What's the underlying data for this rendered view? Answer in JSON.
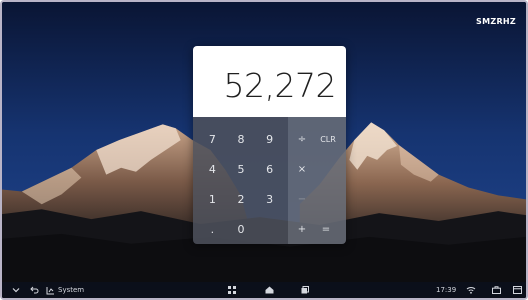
{
  "overlay": {
    "badge": "SMZRHZ"
  },
  "calculator": {
    "display_value": "52,272",
    "number_rows": [
      [
        "7",
        "8",
        "9"
      ],
      [
        "4",
        "5",
        "6"
      ],
      [
        "1",
        "2",
        "3"
      ],
      [
        ".",
        "0",
        ""
      ]
    ],
    "operator_rows": [
      [
        "÷",
        "CLR"
      ],
      [
        "×",
        ""
      ],
      [
        "−",
        ""
      ],
      [
        "+",
        "="
      ]
    ]
  },
  "taskbar": {
    "label": "System",
    "time": "17:39",
    "icons": [
      "chevron-down-icon",
      "back-icon",
      "system-icon",
      "apps-grid-icon",
      "home-icon",
      "recent-apps-icon",
      "wifi-icon",
      "briefcase-icon",
      "window-icon"
    ]
  },
  "colors": {
    "sky_top": "#0b1a3c",
    "sky_bottom": "#1a3a7a",
    "taskbar": "#0b0f1a",
    "operator_panel": "#686c76",
    "number_panel": "#4e525c"
  }
}
